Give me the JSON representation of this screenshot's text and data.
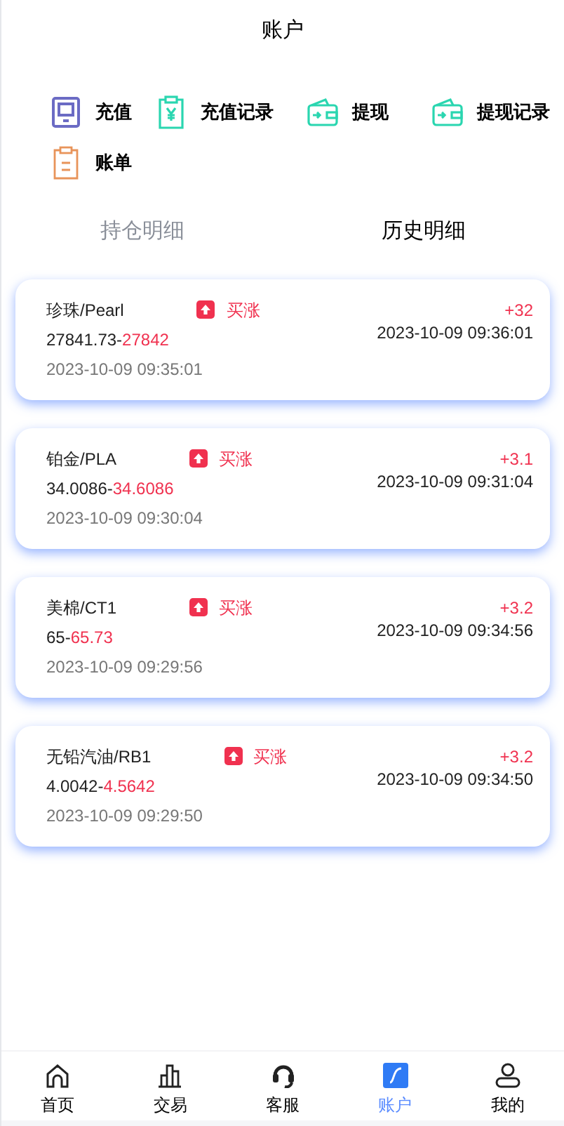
{
  "header": {
    "title": "账户"
  },
  "menu": [
    {
      "label": "充值",
      "color": "#6b6bc4"
    },
    {
      "label": "充值记录",
      "color": "#2ad6b0"
    },
    {
      "label": "提现",
      "color": "#2ad6b0"
    },
    {
      "label": "提现记录",
      "color": "#2ad6b0"
    },
    {
      "label": "账单",
      "color": "#e8945a"
    }
  ],
  "tabs": [
    {
      "label": "持仓明细",
      "selected": false
    },
    {
      "label": "历史明细",
      "selected": true
    }
  ],
  "orders": [
    {
      "name": "珍珠/Pearl",
      "direction": "买涨",
      "open_price": "27841.73",
      "separator": "-",
      "close_price": "27842",
      "open_time": "2023-10-09 09:35:01",
      "profit": "+32",
      "close_time": "2023-10-09 09:36:01"
    },
    {
      "name": "铂金/PLA",
      "direction": "买涨",
      "open_price": "34.0086",
      "separator": "-",
      "close_price": "34.6086",
      "open_time": "2023-10-09 09:30:04",
      "profit": "+3.1",
      "close_time": "2023-10-09 09:31:04"
    },
    {
      "name": "美棉/CT1",
      "direction": "买涨",
      "open_price": "65",
      "separator": "-",
      "close_price": "65.73",
      "open_time": "2023-10-09 09:29:56",
      "profit": "+3.2",
      "close_time": "2023-10-09 09:34:56"
    },
    {
      "name": "无铅汽油/RB1",
      "direction": "买涨",
      "open_price": "4.0042",
      "separator": "-",
      "close_price": "4.5642",
      "open_time": "2023-10-09 09:29:50",
      "profit": "+3.2",
      "close_time": "2023-10-09 09:34:50"
    }
  ],
  "nav": [
    {
      "label": "首页",
      "selected": false
    },
    {
      "label": "交易",
      "selected": false
    },
    {
      "label": "客服",
      "selected": false
    },
    {
      "label": "账户",
      "selected": true
    },
    {
      "label": "我的",
      "selected": false
    }
  ]
}
